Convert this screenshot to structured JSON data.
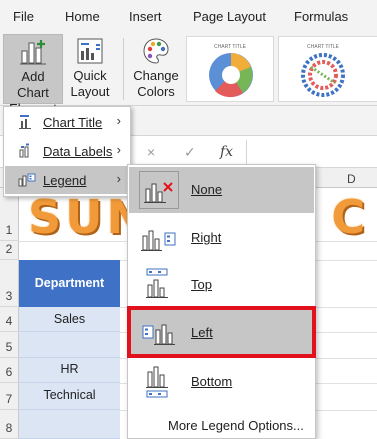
{
  "ribbon_tabs": [
    "File",
    "Home",
    "Insert",
    "Page Layout",
    "Formulas"
  ],
  "ribbon": {
    "add_chart_element": [
      "Add Chart",
      "Element"
    ],
    "quick_layout": [
      "Quick",
      "Layout"
    ],
    "change_colors": [
      "Change",
      "Colors"
    ],
    "thumbnail_title": "CHART TITLE",
    "dropdown_caret": "⌄"
  },
  "formula_bar": {
    "cancel": "×",
    "confirm": "✓",
    "fx": "fx"
  },
  "sheet": {
    "columns": [
      "D"
    ],
    "rows": [
      "1",
      "2",
      "3",
      "4",
      "5",
      "6",
      "7",
      "8"
    ],
    "title_text": "SUN",
    "title_text_end": "T C",
    "dept_header": "Department",
    "cells": [
      "Sales",
      "HR",
      "Technical"
    ]
  },
  "chart_element_menu": {
    "items": [
      {
        "label": "Chart Title",
        "arrow": "›"
      },
      {
        "label": "Data Labels",
        "arrow": "›"
      },
      {
        "label": "Legend",
        "arrow": "›"
      }
    ]
  },
  "legend_submenu": {
    "items": [
      {
        "label": "None"
      },
      {
        "label": "Right"
      },
      {
        "label": "Top"
      },
      {
        "label": "Left"
      },
      {
        "label": "Bottom"
      }
    ],
    "more": "More Legend Options..."
  },
  "colors": {
    "highlight": "#e2121d",
    "header_blue": "#3f72c6",
    "title_orange": "#f19a3a"
  }
}
